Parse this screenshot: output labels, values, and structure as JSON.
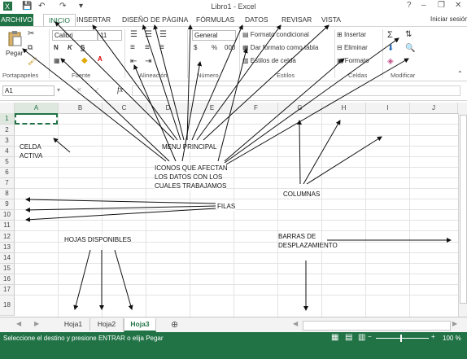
{
  "titlebar": {
    "title": "Libro1 - Excel",
    "minimize": "–",
    "restore": "❐",
    "close": "✕",
    "help": "?"
  },
  "tabs": [
    {
      "label": "ARCHIVO"
    },
    {
      "label": "INICIO"
    },
    {
      "label": "INSERTAR"
    },
    {
      "label": "DISEÑO DE PÁGINA"
    },
    {
      "label": "FÓRMULAS"
    },
    {
      "label": "DATOS"
    },
    {
      "label": "REVISAR"
    },
    {
      "label": "VISTA"
    }
  ],
  "signin": "Iniciar sesión",
  "ribbon": {
    "paste": "Pegar",
    "font_name": "Calibri",
    "font_size": "11",
    "bold": "N",
    "italic": "K",
    "underline": "S",
    "number_format": "General",
    "currency": "$",
    "percent": "%",
    "thousands": "000",
    "conditional": "Formato condicional",
    "as_table": "Dar formato como tabla",
    "cell_styles": "Estilos de celda",
    "insert": "Insertar",
    "delete": "Eliminar",
    "format": "Formato",
    "groups": {
      "clipboard": "Portapapeles",
      "font": "Fuente",
      "alignment": "Alineación",
      "number": "Número",
      "styles": "Estilos",
      "cells": "Celdas",
      "editing": "Modificar"
    }
  },
  "formula_bar": {
    "name_box": "A1",
    "fx": "fx"
  },
  "columns": [
    "A",
    "B",
    "C",
    "D",
    "E",
    "F",
    "G",
    "H",
    "I",
    "J"
  ],
  "rows": [
    "1",
    "2",
    "3",
    "4",
    "5",
    "6",
    "7",
    "8",
    "9",
    "10",
    "11",
    "12",
    "13",
    "14",
    "15",
    "16",
    "17",
    "18"
  ],
  "annotations": {
    "menu_principal": "MENU PRINCIPAL",
    "celda_activa_1": "CELDA",
    "celda_activa_2": "ACTIVA",
    "iconos_1": "ICONOS QUE AFECTAN",
    "iconos_2": "LOS DATOS CON LOS",
    "iconos_3": "CUALES TRABAJAMOS",
    "columnas": "COLUMNAS",
    "filas": "FILAS",
    "hojas": "HOJAS DISPONIBLES",
    "barras_1": "BARRAS DE",
    "barras_2": "DESPLAZAMIENTO"
  },
  "sheets": [
    "Hoja1",
    "Hoja2",
    "Hoja3"
  ],
  "active_sheet": "Hoja3",
  "add_sheet": "⊕",
  "status": {
    "message": "Seleccione el destino y presione ENTRAR o elija Pegar",
    "zoom": "100 %"
  },
  "colors": {
    "accent": "#217346"
  }
}
